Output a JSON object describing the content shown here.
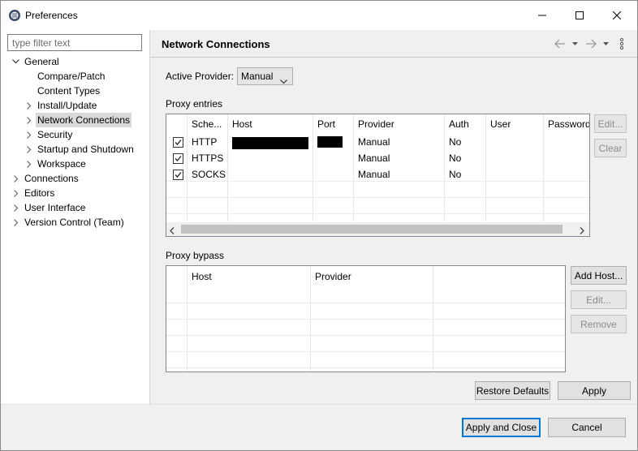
{
  "window": {
    "title": "Preferences",
    "icon": "eclipse-icon",
    "controls": {
      "minimize": "minimize-icon",
      "maximize": "maximize-icon",
      "close": "close-icon"
    }
  },
  "sidebar": {
    "filter_placeholder": "type filter text",
    "tree": [
      {
        "label": "General",
        "expanded": true
      },
      {
        "label": "Compare/Patch"
      },
      {
        "label": "Content Types"
      },
      {
        "label": "Install/Update",
        "expandable": true
      },
      {
        "label": "Network Connections",
        "expandable": true,
        "selected": true
      },
      {
        "label": "Security",
        "expandable": true
      },
      {
        "label": "Startup and Shutdown",
        "expandable": true
      },
      {
        "label": "Workspace",
        "expandable": true
      },
      {
        "label": "Connections",
        "expandable": true
      },
      {
        "label": "Editors",
        "expandable": true
      },
      {
        "label": "User Interface",
        "expandable": true
      },
      {
        "label": "Version Control (Team)",
        "expandable": true
      }
    ]
  },
  "page": {
    "title": "Network Connections",
    "active_provider_label": "Active Provider:",
    "active_provider_value": "Manual",
    "proxy_entries_label": "Proxy entries",
    "proxy_entries": {
      "columns": [
        "Sche...",
        "Host",
        "Port",
        "Provider",
        "Auth",
        "User",
        "Password"
      ],
      "rows": [
        {
          "checked": true,
          "scheme": "HTTP",
          "host_redacted": true,
          "port_redacted": true,
          "provider": "Manual",
          "auth": "No",
          "user": "",
          "password": ""
        },
        {
          "checked": true,
          "scheme": "HTTPS",
          "host": "",
          "port": "",
          "provider": "Manual",
          "auth": "No",
          "user": "",
          "password": ""
        },
        {
          "checked": true,
          "scheme": "SOCKS",
          "host": "",
          "port": "",
          "provider": "Manual",
          "auth": "No",
          "user": "",
          "password": ""
        }
      ],
      "edit_button": "Edit...",
      "clear_button": "Clear"
    },
    "proxy_bypass_label": "Proxy bypass",
    "proxy_bypass": {
      "columns": [
        "Host",
        "Provider"
      ],
      "rows": [],
      "add_host_button": "Add Host...",
      "edit_button": "Edit...",
      "remove_button": "Remove"
    },
    "restore_defaults_button": "Restore Defaults",
    "apply_button": "Apply"
  },
  "footer": {
    "apply_close_button": "Apply and Close",
    "cancel_button": "Cancel"
  },
  "colors": {
    "accent": "#0078d7",
    "selection": "#d9d9d9",
    "redaction": "#000000"
  }
}
